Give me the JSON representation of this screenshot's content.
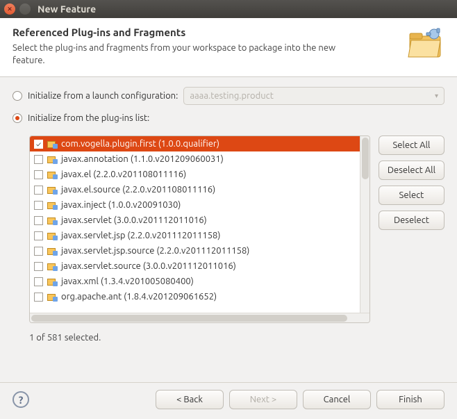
{
  "window": {
    "title": "New Feature"
  },
  "header": {
    "title": "Referenced Plug-ins and Fragments",
    "subtitle": "Select the plug-ins and fragments from your workspace to package into the new feature."
  },
  "options": {
    "launch_label": "Initialize from a launch configuration:",
    "launch_value": "aaaa.testing.product",
    "list_label": "Initialize from the plug-ins list:"
  },
  "plugins": [
    {
      "name": "com.vogella.plugin.first (1.0.0.qualifier)",
      "checked": true,
      "selected": true
    },
    {
      "name": "javax.annotation (1.1.0.v201209060031)",
      "checked": false
    },
    {
      "name": "javax.el (2.2.0.v201108011116)",
      "checked": false
    },
    {
      "name": "javax.el.source (2.2.0.v201108011116)",
      "checked": false
    },
    {
      "name": "javax.inject (1.0.0.v20091030)",
      "checked": false
    },
    {
      "name": "javax.servlet (3.0.0.v201112011016)",
      "checked": false
    },
    {
      "name": "javax.servlet.jsp (2.2.0.v201112011158)",
      "checked": false
    },
    {
      "name": "javax.servlet.jsp.source (2.2.0.v201112011158)",
      "checked": false
    },
    {
      "name": "javax.servlet.source (3.0.0.v201112011016)",
      "checked": false
    },
    {
      "name": "javax.xml (1.3.4.v201005080400)",
      "checked": false
    },
    {
      "name": "org.apache.ant (1.8.4.v201209061652)",
      "checked": false
    }
  ],
  "side_buttons": {
    "select_all": "Select All",
    "deselect_all": "Deselect All",
    "select": "Select",
    "deselect": "Deselect"
  },
  "status": "1 of 581 selected.",
  "footer": {
    "back": "< Back",
    "next": "Next >",
    "cancel": "Cancel",
    "finish": "Finish"
  }
}
